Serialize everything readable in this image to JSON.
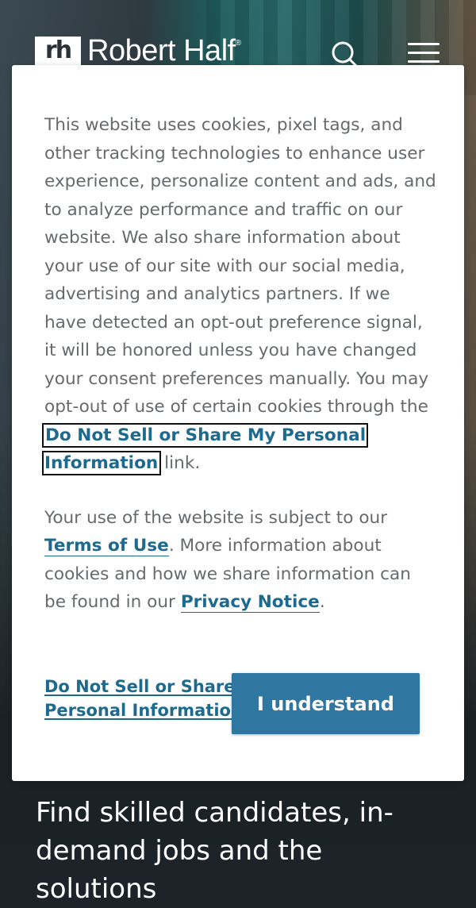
{
  "header": {
    "logo_mark": "rh",
    "logo_text": "Robert Half",
    "logo_reg": "®"
  },
  "cookie_banner": {
    "para1_text": "This website uses cookies, pixel tags, and other tracking technologies to enhance user experience, personalize content and ads, and to analyze performance and traffic on our website. We also share information about your use of our site with our social media, advertising and analytics partners. If we have detected an opt-out preference signal, it will be honored unless you have changed your consent preferences manually. You may opt-out of use of certain cookies through the ",
    "para1_link": "Do Not Sell or Share My Personal Information",
    "para1_suffix": " link.",
    "para2_prefix": "Your use of the website is subject to our ",
    "terms_link": "Terms of Use",
    "para2_middle": ". More information about cookies and how we share information can be found in our ",
    "privacy_link": "Privacy Notice",
    "para2_suffix": ".",
    "footer_link": "Do Not Sell or Share My Personal Information",
    "accept_button": "I understand"
  },
  "hero": {
    "text": "Find skilled candidates, in-demand jobs and the solutions"
  },
  "colors": {
    "accent": "#2f76a0",
    "link": "#1e6a8e"
  }
}
